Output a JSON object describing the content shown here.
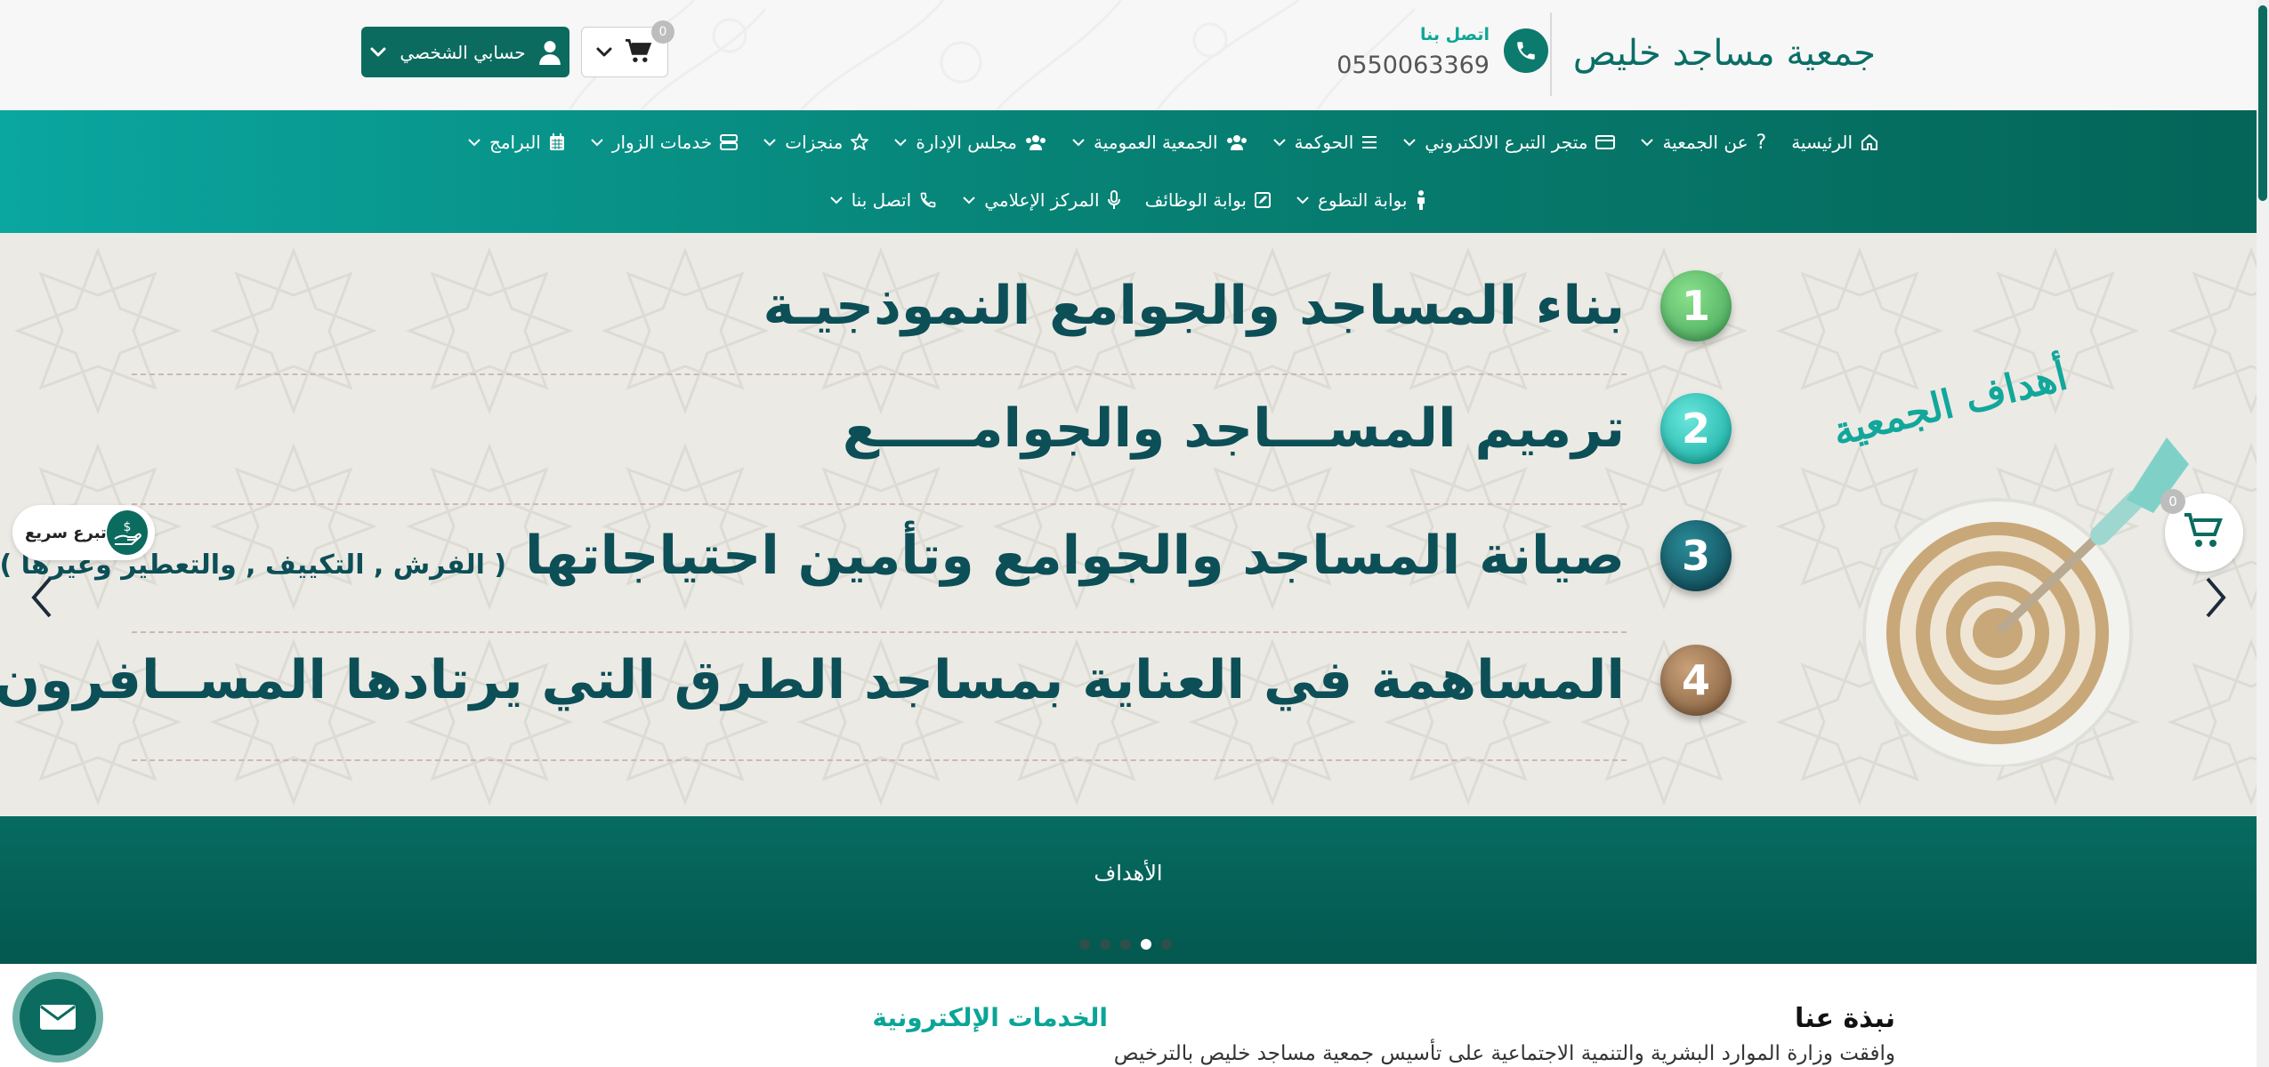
{
  "header": {
    "logo_text": "جمعية مساجد خليص",
    "contact_label": "اتصل بنا",
    "phone": "0550063369",
    "cart_count": "0",
    "account_label": "حسابي الشخصي"
  },
  "nav": {
    "row1": [
      "الرئيسية",
      "عن الجمعية",
      "متجر التبرع الالكتروني",
      "الحوكمة",
      "الجمعية العمومية",
      "مجلس الإدارة",
      "منجزات",
      "خدمات الزوار",
      "البرامج"
    ],
    "row2": [
      "بوابة التطوع",
      "بوابة الوظائف",
      "المركز الإعلامي",
      "اتصل بنا"
    ]
  },
  "slide": {
    "heading": "أهداف الجمعية",
    "goals": [
      {
        "num": "1",
        "text": "بناء المساجد والجوامع النموذجيـة",
        "sub": ""
      },
      {
        "num": "2",
        "text": "ترميم المســـاجد والجوامـــــع",
        "sub": ""
      },
      {
        "num": "3",
        "text": "صيانة المساجد والجوامع وتأمين  احتياجاتها",
        "sub": "( الفرش , التكييف , والتعطير وغيرها )"
      },
      {
        "num": "4",
        "text": "المساهمة في العناية بمساجد الطرق التي يرتادها المســافرون",
        "sub": ""
      }
    ],
    "colors": [
      "#4fc36a",
      "#14b5ac",
      "#0c5260",
      "#8a6a4a"
    ],
    "caption": "الأهداف",
    "dots_count": 5,
    "active_dot": 3
  },
  "quick_donate": {
    "label": "تبرع سريع"
  },
  "float_cart": {
    "count": "0"
  },
  "content": {
    "about_title": "نبذة عنا",
    "about_text": "وافقت وزارة الموارد البشرية والتنمية الاجتماعية على تأسيس جمعية مساجد خليص بالترخيص",
    "eservices_title": "الخدمات الإلكترونية"
  }
}
